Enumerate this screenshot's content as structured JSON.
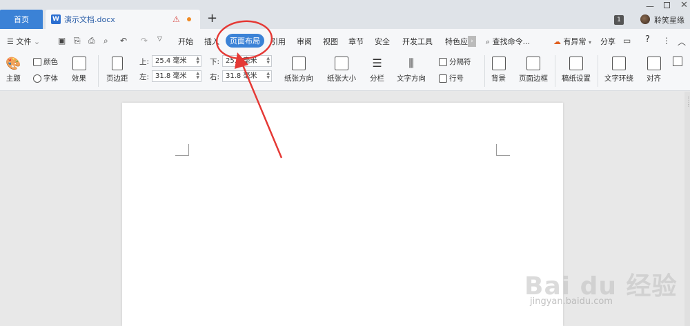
{
  "titlebar": {
    "home_tab": "首页",
    "doc_tab": "演示文档.docx",
    "doc_icon_letter": "W",
    "new_tab": "+",
    "badge": "1",
    "username": "聆笑星缘"
  },
  "menubar": {
    "file": "文件",
    "items": [
      "开始",
      "插入",
      "页面布局",
      "引用",
      "审阅",
      "视图",
      "章节",
      "安全",
      "开发工具",
      "特色应"
    ],
    "active": "页面布局",
    "search": "查找命令...",
    "exception": "有异常",
    "share": "分享",
    "help": "?"
  },
  "ribbon": {
    "theme": "主题",
    "color": "颜色",
    "font": "字体",
    "effect": "效果",
    "margin": "页边距",
    "margin_top_label": "上:",
    "margin_top": "25.4 毫米",
    "margin_bottom_label": "下:",
    "margin_bottom": "25.4 毫米",
    "margin_left_label": "左:",
    "margin_left": "31.8 毫米",
    "margin_right_label": "右:",
    "margin_right": "31.8 毫米",
    "orientation": "纸张方向",
    "size": "纸张大小",
    "columns": "分栏",
    "text_direction": "文字方向",
    "separator": "分隔符",
    "line_numbers": "行号",
    "background": "背景",
    "page_border": "页面边框",
    "manuscript": "稿纸设置",
    "text_wrap": "文字环绕",
    "align": "对齐"
  },
  "watermark": {
    "main": "Bai du 经验",
    "sub": "jingyan.baidu.com"
  },
  "colors": {
    "accent": "#3b82d6",
    "annotation": "#e53935"
  }
}
